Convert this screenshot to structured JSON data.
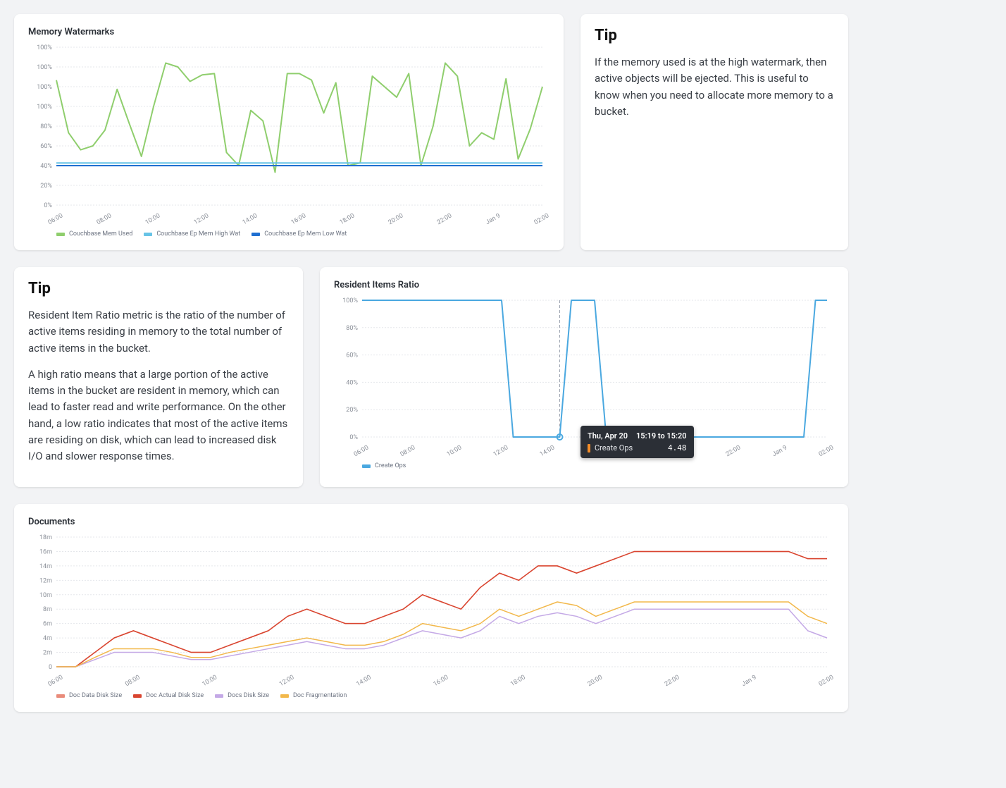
{
  "chart_data": [
    {
      "id": "memory_watermarks",
      "type": "line",
      "title": "Memory Watermarks",
      "xlabel": "",
      "ylabel": "",
      "ylim": [
        0,
        120
      ],
      "y_ticks": [
        "0%",
        "20%",
        "40%",
        "60%",
        "80%",
        "100%",
        "100%",
        "100%",
        "100%"
      ],
      "x_categories": [
        "06:00",
        "08:00",
        "10:00",
        "12:00",
        "14:00",
        "16:00",
        "18:00",
        "20:00",
        "22:00",
        "Jan 9",
        "02:00"
      ],
      "series": [
        {
          "name": "Couchbase Mem Used",
          "color": "#8fce6d",
          "values": [
            95,
            55,
            42,
            45,
            57,
            88,
            62,
            37,
            75,
            108,
            105,
            94,
            99,
            100,
            40,
            30,
            72,
            64,
            25,
            100,
            100,
            95,
            70,
            93,
            30,
            32,
            98,
            90,
            82,
            100,
            30,
            60,
            108,
            98,
            45,
            55,
            50,
            96,
            35,
            58,
            90
          ]
        },
        {
          "name": "Couchbase Ep Mem High Wat",
          "color": "#67c3e6",
          "values": [
            32,
            32,
            32,
            32,
            32,
            32,
            32,
            32,
            32,
            32,
            32,
            32,
            32,
            32,
            32,
            32,
            32,
            32,
            32,
            32,
            32,
            32,
            32,
            32,
            32,
            32,
            32,
            32,
            32,
            32,
            32,
            32,
            32,
            32,
            32,
            32,
            32,
            32,
            32,
            32,
            32
          ]
        },
        {
          "name": "Couchbase Ep Mem Low Wat",
          "color": "#1f6fd1",
          "values": [
            30,
            30,
            30,
            30,
            30,
            30,
            30,
            30,
            30,
            30,
            30,
            30,
            30,
            30,
            30,
            30,
            30,
            30,
            30,
            30,
            30,
            30,
            30,
            30,
            30,
            30,
            30,
            30,
            30,
            30,
            30,
            30,
            30,
            30,
            30,
            30,
            30,
            30,
            30,
            30,
            30
          ]
        }
      ]
    },
    {
      "id": "resident_items_ratio",
      "type": "line",
      "title": "Resident Items Ratio",
      "xlabel": "",
      "ylabel": "",
      "ylim": [
        0,
        100
      ],
      "y_ticks": [
        "0%",
        "20%",
        "40%",
        "60%",
        "80%",
        "100%"
      ],
      "x_categories": [
        "06:00",
        "08:00",
        "10:00",
        "12:00",
        "14:00",
        "16:00",
        "18:00",
        "20:00",
        "22:00",
        "Jan 9",
        "02:00"
      ],
      "series": [
        {
          "name": "Create Ops",
          "color": "#4aa8e0",
          "values": [
            100,
            100,
            100,
            100,
            100,
            100,
            100,
            100,
            100,
            100,
            100,
            100,
            100,
            0,
            0,
            0,
            0,
            0,
            100,
            100,
            100,
            0,
            0,
            0,
            0,
            0,
            0,
            0,
            0,
            0,
            0,
            0,
            0,
            0,
            0,
            0,
            0,
            0,
            0,
            100,
            100
          ]
        }
      ],
      "tooltip": {
        "date": "Thu, Apr 20",
        "range": "15:19 to 15:20",
        "series": "Create Ops",
        "value": "4.48",
        "swatch": "#f28c28"
      },
      "marker_x_index": 17
    },
    {
      "id": "documents",
      "type": "line",
      "title": "Documents",
      "xlabel": "",
      "ylabel": "",
      "ylim": [
        0,
        18
      ],
      "y_ticks": [
        "0",
        "2m",
        "4m",
        "6m",
        "8m",
        "10m",
        "12m",
        "14m",
        "16m",
        "18m"
      ],
      "x_categories": [
        "06:00",
        "08:00",
        "10:00",
        "12:00",
        "14:00",
        "16:00",
        "18:00",
        "20:00",
        "22:00",
        "Jan 9",
        "02:00"
      ],
      "series": [
        {
          "name": "Doc Data Disk Size",
          "color": "#e98b7a",
          "values": [
            0,
            0,
            2,
            4,
            5,
            4,
            3,
            2,
            2,
            3,
            4,
            5,
            7,
            8,
            7,
            6,
            6,
            7,
            8,
            10,
            9,
            8,
            11,
            13,
            12,
            14,
            14,
            13,
            14,
            15,
            16,
            16,
            16,
            16,
            16,
            16,
            16,
            16,
            16,
            15,
            15
          ]
        },
        {
          "name": "Doc Actual Disk Size",
          "color": "#d94530",
          "values": [
            0,
            0,
            2,
            4,
            5,
            4,
            3,
            2,
            2,
            3,
            4,
            5,
            7,
            8,
            7,
            6,
            6,
            7,
            8,
            10,
            9,
            8,
            11,
            13,
            12,
            14,
            14,
            13,
            14,
            15,
            16,
            16,
            16,
            16,
            16,
            16,
            16,
            16,
            16,
            15,
            15
          ]
        },
        {
          "name": "Docs Disk Size",
          "color": "#c4a9e6",
          "values": [
            0,
            0,
            1,
            2,
            2,
            2,
            1.5,
            1,
            1,
            1.5,
            2,
            2.5,
            3,
            3.5,
            3,
            2.5,
            2.5,
            3,
            4,
            5,
            4.5,
            4,
            5,
            7,
            6,
            7,
            7.5,
            7,
            6,
            7,
            8,
            8,
            8,
            8,
            8,
            8,
            8,
            8,
            8,
            5,
            4
          ]
        },
        {
          "name": "Doc Fragmentation",
          "color": "#f2b84b",
          "values": [
            0,
            0,
            1.3,
            2.5,
            2.5,
            2.5,
            2,
            1.3,
            1.3,
            2,
            2.5,
            3,
            3.5,
            4,
            3.5,
            3,
            3,
            3.5,
            4.5,
            6,
            5.5,
            5,
            6,
            8,
            7,
            8,
            9,
            8.5,
            7,
            8,
            9,
            9,
            9,
            9,
            9,
            9,
            9,
            9,
            9,
            7,
            6
          ]
        }
      ]
    }
  ],
  "tips": {
    "memory": {
      "title": "Tip",
      "body": "If the memory used is at the high watermark, then active objects will be ejected. This is useful to know when you need to allocate more memory to a bucket."
    },
    "resident": {
      "title": "Tip",
      "para1": "Resident Item Ratio metric is the ratio of the number of active items residing in memory to the total number of active items in the bucket.",
      "para2": "A high ratio means that a large portion of the active items in the bucket are resident in memory, which can lead to faster read and write performance. On the other hand, a low ratio indicates that most of the active items are residing on disk, which can lead to increased disk I/O and slower response times."
    }
  }
}
